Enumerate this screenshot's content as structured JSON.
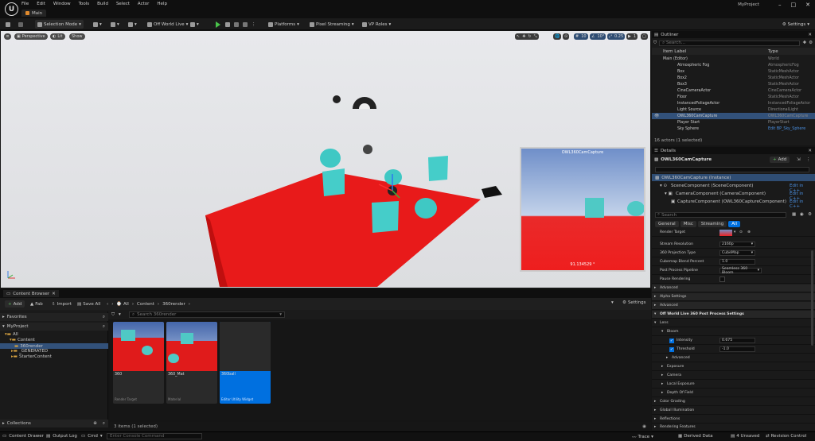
{
  "menu": [
    "File",
    "Edit",
    "Window",
    "Tools",
    "Build",
    "Select",
    "Actor",
    "Help"
  ],
  "tab_main": "Main",
  "project_name": "MyProject",
  "toolbar": {
    "selection_mode": "Selection Mode",
    "off_world_live": "Off World Live",
    "platforms": "Platforms",
    "pixel_streaming": "Pixel Streaming",
    "vp_roles": "VP Roles",
    "settings": "Settings"
  },
  "viewport": {
    "perspective": "Perspective",
    "lit": "Lit",
    "show": "Show",
    "grid_snap": "10",
    "rot_snap": "10°",
    "scale_snap": "0.25",
    "cam_speed": "1",
    "preview_title": "OWL360CamCapture",
    "preview_value": "91.134529 °"
  },
  "outliner": {
    "tab": "Outliner",
    "search_placeholder": "Search...",
    "col_label": "Item Label",
    "col_type": "Type",
    "rows": [
      {
        "label": "Main (Editor)",
        "type": "World"
      },
      {
        "label": "Atmospheric Fog",
        "type": "AtmosphericFog"
      },
      {
        "label": "Box",
        "type": "StaticMeshActor"
      },
      {
        "label": "Box2",
        "type": "StaticMeshActor"
      },
      {
        "label": "Box3",
        "type": "StaticMeshActor"
      },
      {
        "label": "CineCameraActor",
        "type": "CineCameraActor"
      },
      {
        "label": "Floor",
        "type": "StaticMeshActor"
      },
      {
        "label": "InstancedFoliageActor",
        "type": "InstancedFoliageActor"
      },
      {
        "label": "Light Source",
        "type": "DirectionalLight"
      },
      {
        "label": "OWL360CamCapture",
        "type": "OWL360CamCapture"
      },
      {
        "label": "Player Start",
        "type": "PlayerStart"
      },
      {
        "label": "Sky Sphere",
        "type": "Edit BP_Sky_Sphere"
      }
    ],
    "status": "16 actors (1 selected)"
  },
  "details": {
    "tab": "Details",
    "actor_name": "OWL360CamCapture",
    "add": "Add",
    "instance": "OWL360CamCapture (Instance)",
    "components": [
      {
        "label": "SceneComponent (SceneComponent)",
        "link": "Edit in C++"
      },
      {
        "label": "CameraComponent (CameraComponent)",
        "link": "Edit in C++"
      },
      {
        "label": "CaptureComponent (OWL360CaptureComponent)",
        "link": "Edit in C++"
      }
    ],
    "search_placeholder": "Search",
    "filter_tabs": [
      "General",
      "Misc",
      "Streaming",
      "All"
    ],
    "render_target": "Render Target",
    "props": [
      {
        "label": "Stream Resolution",
        "value": "2160p"
      },
      {
        "label": "360 Projection Type",
        "value": "CubeMap"
      },
      {
        "label": "Cubemap Blend Percent",
        "value": "1.0"
      },
      {
        "label": "Post Process Pipeline",
        "value": "Seamless 360 Bloom"
      },
      {
        "label": "Pause Rendering",
        "value": ""
      }
    ],
    "sections": [
      "Advanced",
      "Alpha Settings",
      "Advanced"
    ],
    "pp_header": "Off World Live 360 Post Process Settings",
    "lens": "Lens",
    "bloom": "Bloom",
    "intensity": {
      "label": "Intensity",
      "value": "0.675"
    },
    "threshold": {
      "label": "Threshold",
      "value": "-1.0"
    },
    "bloom_advanced": "Advanced",
    "lens_sub": [
      "Exposure",
      "Camera",
      "Local Exposure",
      "Depth Of Field"
    ],
    "more": [
      "Color Grading",
      "Global Illumination",
      "Reflections",
      "Rendering Features"
    ]
  },
  "content_browser": {
    "tab": "Content Browser",
    "add": "Add",
    "fab": "Fab",
    "import": "Import",
    "save_all": "Save All",
    "path": [
      "All",
      "Content",
      "360render"
    ],
    "settings": "Settings",
    "favorites": "Favorites",
    "project": "MyProject",
    "search_placeholder": "Search 360render",
    "tree": [
      "All",
      "Content",
      "360render",
      "_GENERATED",
      "StarterContent"
    ],
    "collections": "Collections",
    "assets": [
      {
        "name": "360",
        "type": "Render Target"
      },
      {
        "name": "360_Mat",
        "type": "Material"
      },
      {
        "name": "360ball",
        "type": "Editor Utility Widget"
      }
    ],
    "status": "3 items (1 selected)"
  },
  "statusbar": {
    "drawer": "Content Drawer",
    "output": "Output Log",
    "cmd": "Cmd",
    "console_placeholder": "Enter Console Command",
    "trace": "Trace",
    "derived": "Derived Data",
    "unsaved": "4 Unsaved",
    "revision": "Revision Control"
  }
}
